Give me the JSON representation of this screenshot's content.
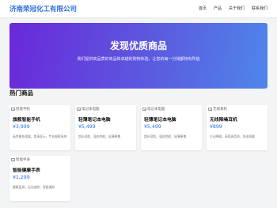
{
  "header": {
    "brand": "济南荣冠化工有限公司",
    "nav": [
      "首页",
      "产品",
      "关于我们",
      "联系我们"
    ]
  },
  "hero": {
    "title": "发现优质商品",
    "subtitle": "我们提供高品质的商品和卓越的购物体验，让您的每一分钱都物有所值"
  },
  "products_section": {
    "title": "热门商品",
    "items": [
      {
        "image_alt": "智能手机",
        "name": "旗舰智能手机",
        "price": "¥3,999",
        "desc": "高性能处理器，超清显示，专业摄影系统"
      },
      {
        "image_alt": "笔记本电脑",
        "name": "轻薄笔记本电脑",
        "price": "¥5,499",
        "desc": "超长续航，强劲性能，轻薄便携"
      },
      {
        "image_alt": "笔记本电脑",
        "name": "轻薄笔记本电脑",
        "price": "¥5,499",
        "desc": "超长续航，强劲性能，轻薄便携"
      },
      {
        "image_alt": "无线耳机",
        "name": "无线降噪耳机",
        "price": "¥899",
        "desc": "主动降噪，高保真音质，舒适佩戴"
      },
      {
        "image_alt": "智能手表",
        "name": "智能健康手表",
        "price": "¥1,299",
        "desc": "健康监测，运动追踪，智能通知"
      }
    ]
  },
  "colors": {
    "brand": "#2f6fdf",
    "hero_gradient_start": "#6a28d9",
    "hero_gradient_end": "#4f86ea",
    "page_bg": "#f3f4f6"
  }
}
